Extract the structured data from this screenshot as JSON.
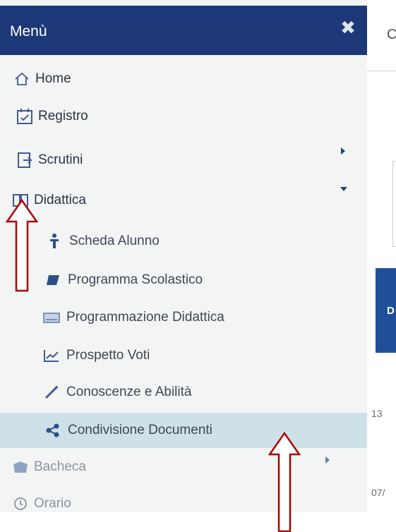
{
  "header": {
    "title": "Menù",
    "close_icon": "close-x-icon"
  },
  "menu": {
    "home": "Home",
    "registro": "Registro",
    "scrutini": "Scrutini",
    "didattica": "Didattica",
    "didattica_sub": {
      "scheda_alunno": "Scheda Alunno",
      "programma_scolastico": "Programma Scolastico",
      "programmazione_didattica": "Programmazione Didattica",
      "prospetto_voti": "Prospetto Voti",
      "conoscenze_abilita": "Conoscenze e Abilità",
      "condivisione_documenti": "Condivisione Documenti"
    },
    "bacheca": "Bacheca",
    "orario": "Orario"
  },
  "content": {
    "tab_letter": "C",
    "blue_letter": "D",
    "date_1": "13",
    "date_2": "07/"
  },
  "colors": {
    "header_bg": "#1c3878",
    "selected_bg": "#cfe1e8",
    "arrow": "#b00000"
  }
}
